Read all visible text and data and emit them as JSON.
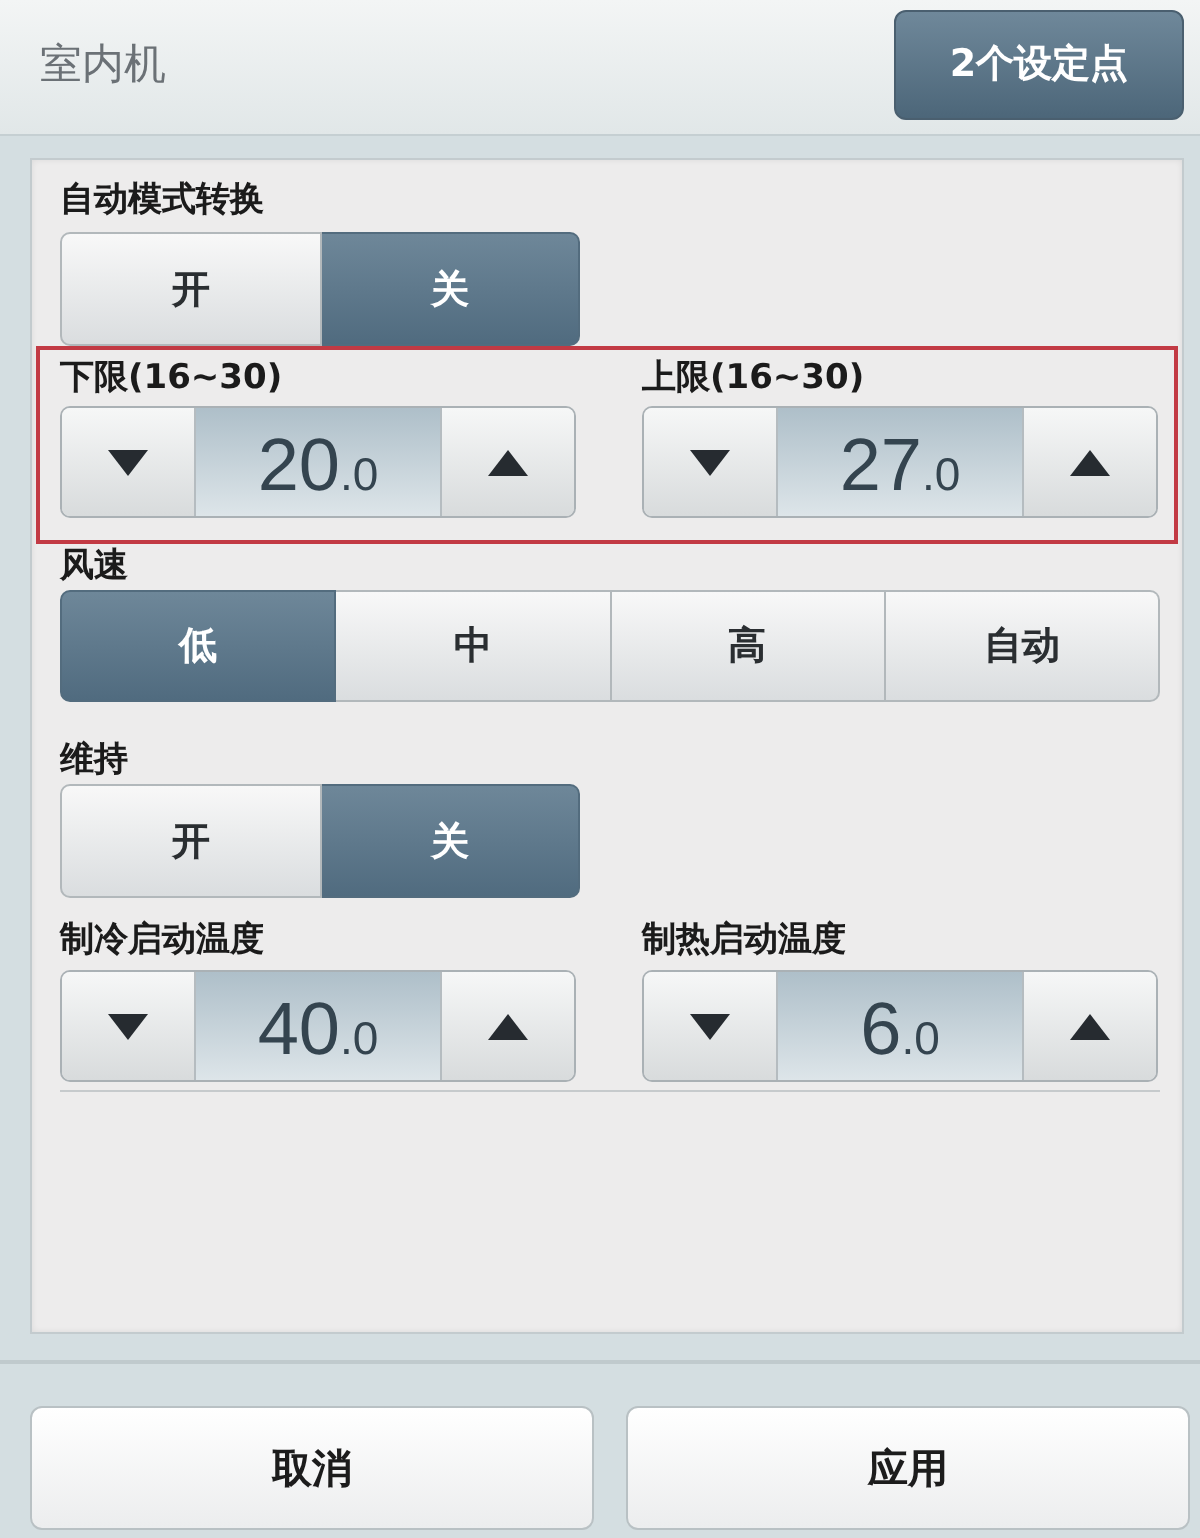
{
  "window": {
    "title": "室内机",
    "setpoints_button": "2个设定点"
  },
  "sections": [
    {
      "kind": "toggle",
      "label": "自动模式转换",
      "options": [
        {
          "label": "开",
          "selected": false
        },
        {
          "label": "关",
          "selected": true
        }
      ]
    },
    {
      "kind": "steppers",
      "highlighted": true,
      "items": [
        {
          "label": "下限(16~30)",
          "value": "20",
          "decimal": ".0"
        },
        {
          "label": "上限(16~30)",
          "value": "27",
          "decimal": ".0"
        }
      ]
    },
    {
      "kind": "segmented",
      "label": "风速",
      "options": [
        {
          "label": "低",
          "selected": true
        },
        {
          "label": "中",
          "selected": false
        },
        {
          "label": "高",
          "selected": false
        },
        {
          "label": "自动",
          "selected": false
        }
      ]
    },
    {
      "kind": "toggle",
      "label": "维持",
      "options": [
        {
          "label": "开",
          "selected": false
        },
        {
          "label": "关",
          "selected": true
        }
      ]
    },
    {
      "kind": "steppers",
      "items": [
        {
          "label": "制冷启动温度",
          "value": "40",
          "decimal": ".0"
        },
        {
          "label": "制热启动温度",
          "value": "6",
          "decimal": ".0"
        }
      ]
    }
  ],
  "buttons": [
    {
      "label": "取消"
    },
    {
      "label": "应用"
    }
  ]
}
